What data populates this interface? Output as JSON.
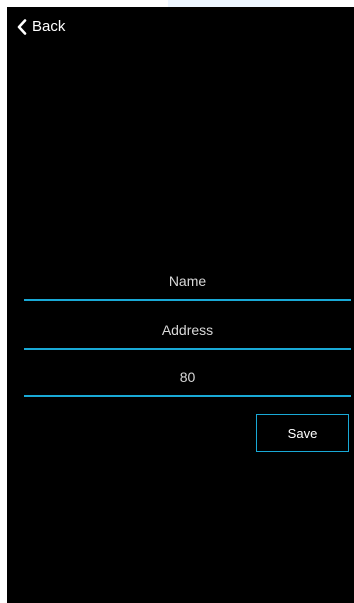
{
  "nav": {
    "back_label": "Back",
    "back_icon": "chevron-left-icon"
  },
  "form": {
    "name_value": "Name",
    "address_value": "Address",
    "port_value": "80",
    "save_label": "Save"
  },
  "colors": {
    "background": "#000000",
    "accent": "#19a9d6",
    "text": "#ffffff",
    "field_text": "#d8d8d8"
  }
}
